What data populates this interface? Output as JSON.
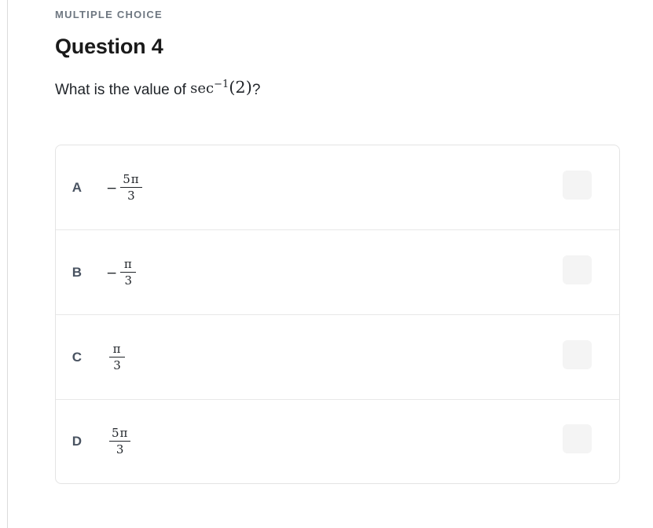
{
  "page": {
    "kicker": "MULTIPLE CHOICE",
    "title": "Question 4",
    "question_prefix": "What is the value of ",
    "question_suffix": "?",
    "math": {
      "function": "sec",
      "exponent": "−1",
      "open_paren": "(",
      "argument": "2",
      "close_paren": ")"
    }
  },
  "colors": {
    "page_background": "#ffffff",
    "kicker_text": "#6e7781",
    "title_text": "#1a1a1a",
    "body_text": "#1f2328",
    "card_border": "#e4e4e4",
    "row_divider": "#e8e8e8",
    "selector_fill": "#f4f4f4",
    "letter_text": "#495361",
    "page_rule": "#dcdcdc"
  },
  "answers": [
    {
      "letter": "A",
      "negative": "−",
      "numerator": "5π",
      "denominator": "3",
      "text": "−5π/3",
      "selected": false
    },
    {
      "letter": "B",
      "negative": "−",
      "numerator": "π",
      "denominator": "3",
      "text": "−π/3",
      "selected": false
    },
    {
      "letter": "C",
      "negative": "",
      "numerator": "π",
      "denominator": "3",
      "text": "π/3",
      "selected": false
    },
    {
      "letter": "D",
      "negative": "",
      "numerator": "5π",
      "denominator": "3",
      "text": "5π/3",
      "selected": false
    }
  ]
}
